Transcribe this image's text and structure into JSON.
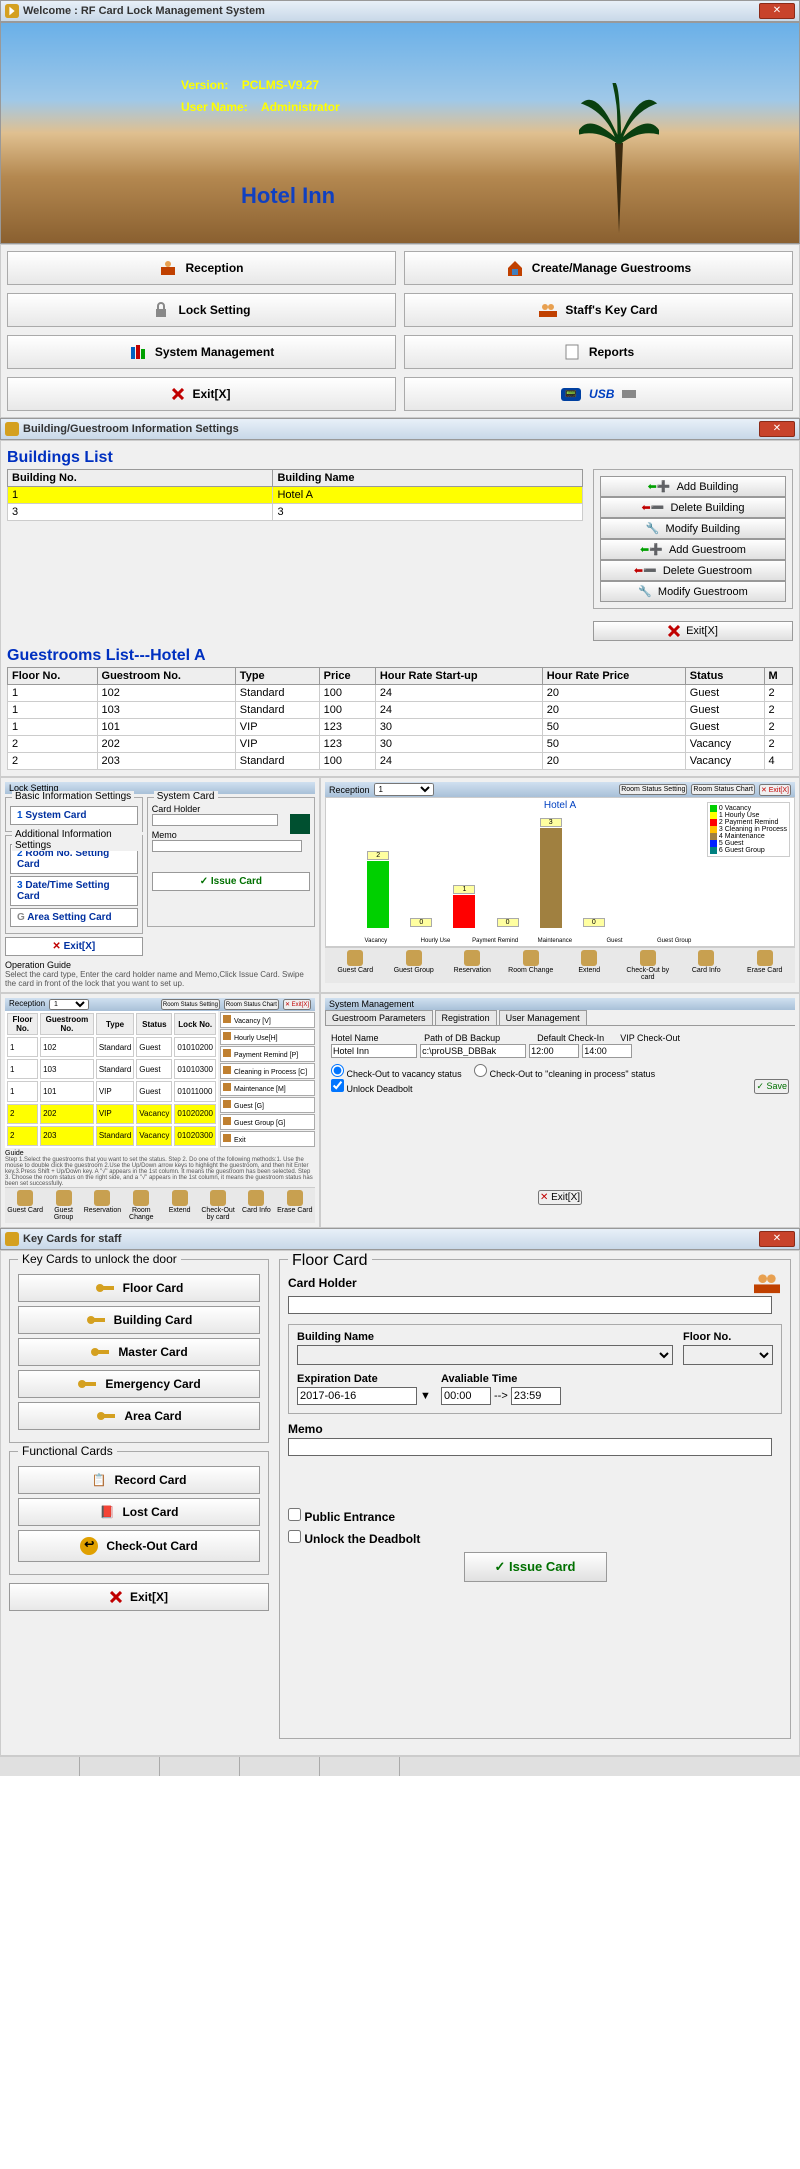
{
  "welcome": {
    "title": "Welcome :  RF Card Lock Management System",
    "version_label": "Version:",
    "version": "PCLMS-V9.27",
    "user_label": "User Name:",
    "user": "Administrator",
    "hotel": "Hotel Inn"
  },
  "menu": {
    "reception": "Reception",
    "create_rooms": "Create/Manage Guestrooms",
    "lock_setting": "Lock Setting",
    "staff_key": "Staff's Key Card",
    "sys_mgmt": "System Management",
    "reports": "Reports",
    "exit": "Exit[X]",
    "usb": "USB"
  },
  "bg": {
    "title": "Building/Guestroom Information Settings",
    "buildings_head": "Buildings List",
    "col_bno": "Building No.",
    "col_bname": "Building Name",
    "buildings": [
      {
        "no": "1",
        "name": "Hotel A",
        "sel": true
      },
      {
        "no": "3",
        "name": "3",
        "sel": false
      }
    ],
    "btns": {
      "add_b": "Add Building",
      "del_b": "Delete Building",
      "mod_b": "Modify Building",
      "add_g": "Add Guestroom",
      "del_g": "Delete Guestroom",
      "mod_g": "Modify Guestroom",
      "exit": "Exit[X]"
    },
    "rooms_head": "Guestrooms List---Hotel A",
    "rcols": {
      "floor": "Floor No.",
      "gno": "Guestroom No.",
      "type": "Type",
      "price": "Price",
      "hrs": "Hour Rate Start-up",
      "hrp": "Hour Rate Price",
      "status": "Status",
      "m": "M"
    },
    "rooms": [
      {
        "f": "1",
        "g": "102",
        "t": "Standard",
        "p": "100",
        "s": "24",
        "hp": "20",
        "st": "Guest",
        "m": "2"
      },
      {
        "f": "1",
        "g": "103",
        "t": "Standard",
        "p": "100",
        "s": "24",
        "hp": "20",
        "st": "Guest",
        "m": "2"
      },
      {
        "f": "1",
        "g": "101",
        "t": "VIP",
        "p": "123",
        "s": "30",
        "hp": "50",
        "st": "Guest",
        "m": "2"
      },
      {
        "f": "2",
        "g": "202",
        "t": "VIP",
        "p": "123",
        "s": "30",
        "hp": "50",
        "st": "Vacancy",
        "m": "2"
      },
      {
        "f": "2",
        "g": "203",
        "t": "Standard",
        "p": "100",
        "s": "24",
        "hp": "20",
        "st": "Vacancy",
        "m": "4"
      }
    ]
  },
  "lock": {
    "title": "Lock Setting",
    "basic": "Basic Information Settings",
    "b1": "System Card",
    "addl": "Additional Information Settings",
    "b2": "Room No. Setting Card",
    "b3": "Date/Time Setting Card",
    "b4": "Area Setting Card",
    "exit": "Exit[X]",
    "guide_h": "Operation Guide",
    "guide": "Select the card type, Enter the card holder name and Memo,Click Issue Card. Swipe the card in front of the  lock that you want to set up.",
    "syscard": "System Card",
    "cardholder": "Card Holder",
    "memo": "Memo",
    "issue": "Issue Card"
  },
  "chart_data": {
    "type": "bar",
    "title": "Hotel A",
    "categories": [
      "Vacancy",
      "Hourly Use",
      "Payment Remind",
      "Maintenance",
      "Guest",
      "Guest Group"
    ],
    "values": [
      2,
      0,
      1,
      0,
      3,
      0
    ],
    "ylim": [
      0,
      3
    ],
    "legend": [
      "Vacancy",
      "Hourly Use",
      "Payment Remind",
      "Cleaning in Process",
      "Maintenance",
      "Guest",
      "Guest Group"
    ],
    "colors": [
      "#00d000",
      "#ffff00",
      "#ff0000",
      "#ffc000",
      "#a08040",
      "#0020ff",
      "#008080"
    ]
  },
  "recp": {
    "title": "Reception",
    "btns": {
      "rss": "Room Status Setting",
      "rsc": "Room Status Chart",
      "exit": "Exit[X]"
    },
    "tb": [
      "Guest Card",
      "Guest Group",
      "Reservation",
      "Room Change",
      "Extend",
      "Check-Out by card",
      "Card Info",
      "Erase Card"
    ],
    "status": [
      "Vacancy [V]",
      "Hourly Use[H]",
      "Payment Remind [P]",
      "Cleaning in Process [C]",
      "Maintenance [M]",
      "Guest [G]",
      "Guest Group [G]",
      "Exit"
    ],
    "mini": {
      "cols": [
        "Floor No.",
        "Guestroom No.",
        "Type",
        "Status",
        "Lock No."
      ],
      "rows": [
        [
          "1",
          "102",
          "Standard",
          "Guest",
          "01010200"
        ],
        [
          "1",
          "103",
          "Standard",
          "Guest",
          "01010300"
        ],
        [
          "1",
          "101",
          "VIP",
          "Guest",
          "01011000"
        ],
        [
          "2",
          "202",
          "VIP",
          "Vacancy",
          "01020200"
        ],
        [
          "2",
          "203",
          "Standard",
          "Vacancy",
          "01020300"
        ]
      ]
    },
    "guide_h": "Guide",
    "guide": "Step 1.Select the guestrooms that you want to set the status. Step 2. Do one of the following methods:1. Use the mouse to double click the guestroom 2.Use the Up/Down arrow keys to highlight the guestroom, and then hit Enter key.3.Press Shift + Up/Down key. A \"√\" appears in the 1st column. It means the guestroom has been selected. Step 3. Choose the room status on the right side, and a \"√\" appears in the 1st column, it means the guestroom status has been set successfully."
  },
  "sysm": {
    "title": "System Management",
    "tabs": [
      "Guestroom Parameters",
      "Registration",
      "User Management"
    ],
    "hotel_l": "Hotel Name",
    "hotel_v": "Hotel Inn",
    "path_l": "Path of DB Backup",
    "path_v": "c:\\proUSB_DBBak",
    "ci_l": "Default Check-In",
    "co_l": "VIP Check-Out",
    "ci_v": "12:00",
    "co_v": "14:00",
    "opt1": "Check-Out to vacancy status",
    "opt2": "Check-Out to \"cleaning in process\" status",
    "opt3": "Unlock Deadbolt",
    "save": "Save",
    "exit": "Exit[X]"
  },
  "kc": {
    "title": "Key Cards for staff",
    "h1": "Key Cards to unlock the door",
    "b1": "Floor Card",
    "b2": "Building Card",
    "b3": "Master Card",
    "b4": "Emergency Card",
    "b5": "Area Card",
    "h2": "Functional Cards",
    "b6": "Record Card",
    "b7": "Lost Card",
    "b8": "Check-Out Card",
    "exit": "Exit[X]",
    "fc": {
      "title": "Floor Card",
      "ch": "Card Holder",
      "bn": "Building Name",
      "fn": "Floor No.",
      "exp": "Expiration Date",
      "exp_v": "2017-06-16",
      "av": "Avaliable Time",
      "av1": "00:00",
      "arrow": "-->",
      "av2": "23:59",
      "memo": "Memo",
      "pe": "Public Entrance",
      "ud": "Unlock the Deadbolt",
      "issue": "Issue Card"
    }
  }
}
